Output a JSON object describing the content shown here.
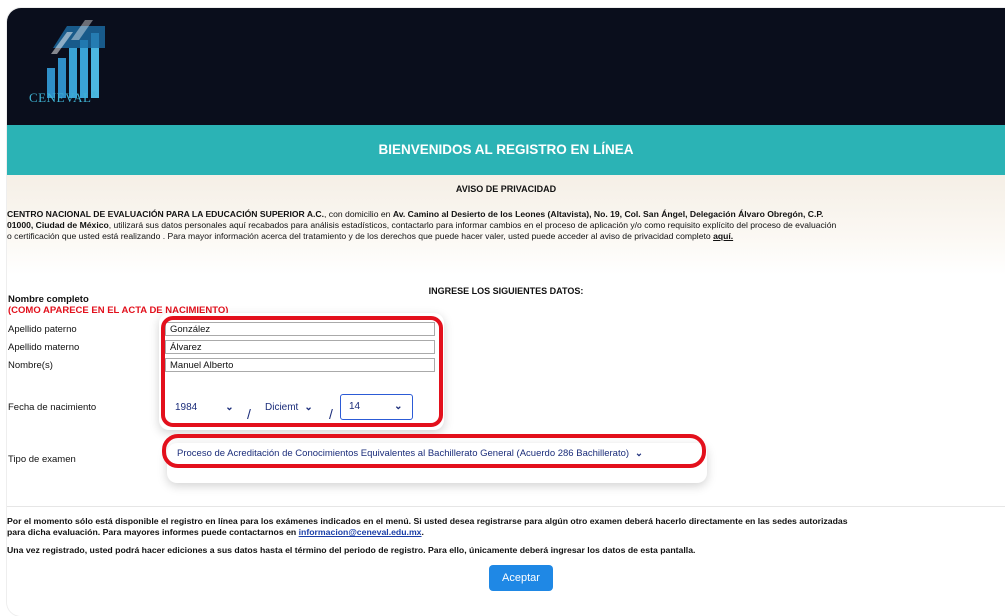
{
  "logo": {
    "name": "CENEVAL",
    "mark": "®"
  },
  "banner": {
    "title": "BIENVENIDOS AL REGISTRO EN LÍNEA"
  },
  "privacy": {
    "title": "AVISO DE PRIVACIDAD",
    "org": "CENTRO NACIONAL DE EVALUACIÓN PARA LA EDUCACIÓN SUPERIOR A.C.",
    "text1": ", con domicilio en ",
    "address": "Av. Camino al Desierto de los Leones (Altavista), No. 19, Col. San Ángel, Delegación Álvaro Obregón, C.P.",
    "city": "01000, Ciudad de México",
    "text2": ", utilizará sus datos personales aquí recabados para análisis estadísticos, contactarlo para informar cambios en el proceso de aplicación y/o como requisito explícito del proceso de evaluación",
    "text3": "o certificación que usted está realizando . Para mayor información acerca del tratamiento y de los derechos que puede hacer valer, usted puede acceder al aviso de privacidad completo ",
    "link": "aquí."
  },
  "form": {
    "title": "INGRESE LOS SIGUIENTES DATOS:",
    "section_label": "Nombre completo",
    "section_note": "(COMO APARECE EN EL ACTA DE NACIMIENTO)",
    "apellido_paterno_label": "Apellido paterno",
    "apellido_paterno": "González",
    "apellido_materno_label": "Apellido materno",
    "apellido_materno": "Álvarez",
    "nombre_label": "Nombre(s)",
    "nombre": "Manuel Alberto",
    "fecha_label": "Fecha de nacimiento",
    "year": "1984",
    "month": "Diciemt",
    "day": "14",
    "exam_label": "Tipo de examen",
    "exam": "Proceso de Acreditación de Conocimientos Equivalentes al Bachillerato General (Acuerdo 286 Bachillerato)"
  },
  "footer": {
    "line1": "Por el momento sólo está disponible el registro en línea para los exámenes indicados en el menú. Si usted desea registrarse para algún otro examen deberá hacerlo directamente en las sedes autorizadas",
    "line2": "para dicha evaluación. Para mayores informes puede contactarnos en ",
    "email": "informacion@ceneval.edu.mx",
    "line2_end": ".",
    "line3": "Una vez registrado, usted podrá hacer ediciones a sus datos hasta el término del periodo de registro. Para ello, únicamente deberá ingresar los datos de esta pantalla.",
    "accept_label": "Aceptar"
  },
  "colors": {
    "banner": "#2bb3b5",
    "highlight": "#e3101c",
    "accept": "#1f88e5",
    "header": "#0a0e1c"
  }
}
